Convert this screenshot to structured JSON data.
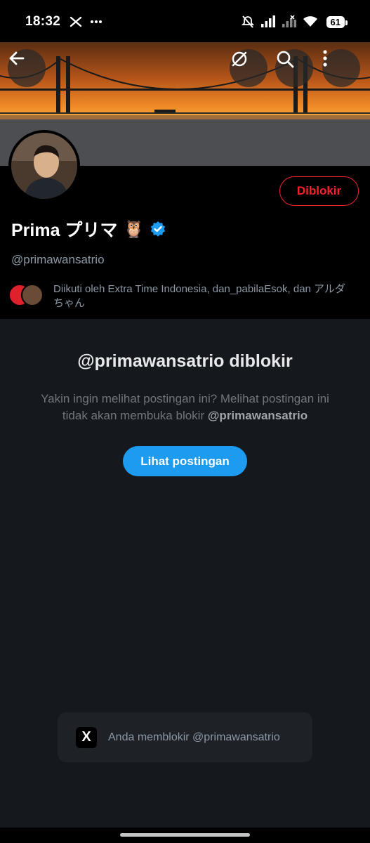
{
  "statusbar": {
    "time": "18:32",
    "battery": "61"
  },
  "profile": {
    "name": "Prima プリマ",
    "emoji": "🦉",
    "handle": "@primawansatrio",
    "blocked_label": "Diblokir",
    "followers_text": "Diikuti oleh Extra Time Indonesia, dan_pabilaEsok, dan アルダちゃん"
  },
  "notice": {
    "title": "@primawansatrio diblokir",
    "body": "Yakin ingin melihat postingan ini? Melihat postingan ini tidak akan membuka blokir",
    "body_handle": "@primawansatrio",
    "button": "Lihat postingan"
  },
  "toast": {
    "icon_text": "X",
    "text": "Anda memblokir @primawansatrio"
  },
  "colors": {
    "accent": "#1d9bf0",
    "blocked": "#f4212e",
    "background": "#15181d"
  },
  "icons": [
    "back-arrow-icon",
    "no-translate-icon",
    "search-icon",
    "more-vertical-icon",
    "verified-badge-icon",
    "x-logo-icon"
  ]
}
